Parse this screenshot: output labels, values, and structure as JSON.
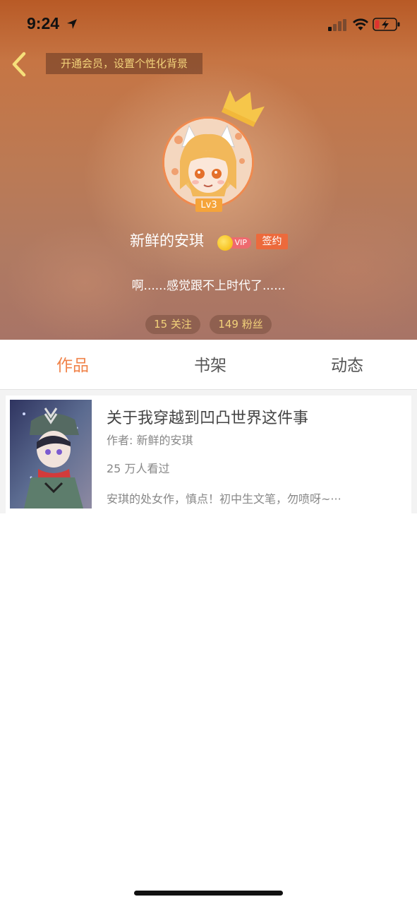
{
  "status_bar": {
    "time": "9:24",
    "icons": [
      "location-arrow-icon",
      "signal-icon",
      "wifi-icon",
      "battery-charging-icon"
    ]
  },
  "header": {
    "back_icon": "chevron-left-icon",
    "vip_banner": "开通会员，设置个性化背景",
    "crown_icon": "crown-icon",
    "level": "Lv3",
    "username": "新鲜的安琪",
    "vip_label": "VIP",
    "contract_label": "签约",
    "bio": "啊......感觉跟不上时代了......",
    "following": "15 关注",
    "followers": "149 粉丝"
  },
  "tabs": [
    {
      "label": "作品",
      "active": true
    },
    {
      "label": "书架",
      "active": false
    },
    {
      "label": "动态",
      "active": false
    }
  ],
  "works": [
    {
      "title": "关于我穿越到凹凸世界这件事",
      "author": "作者: 新鲜的安琪",
      "views": "25 万人看过",
      "description": "安琪的处女作，慎点！初中生文笔，勿喷呀~···"
    }
  ],
  "colors": {
    "accent": "#f0834a",
    "vip_banner_text": "#f3d27a",
    "level_badge": "#f5a43a",
    "contract_badge": "#ec6a3c",
    "vip_pill": "#ee6a6f"
  }
}
